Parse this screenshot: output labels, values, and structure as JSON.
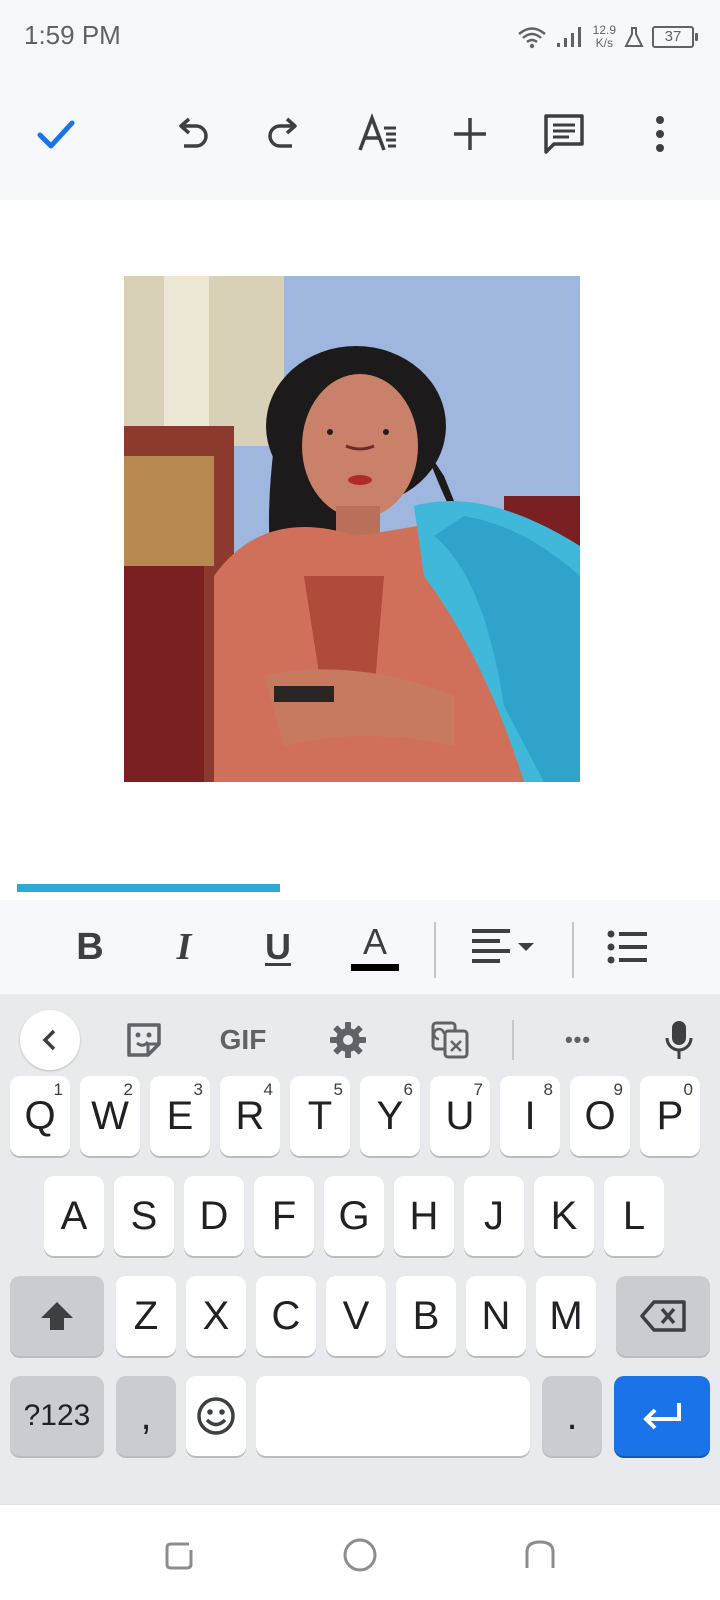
{
  "status_bar": {
    "time": "1:59 PM",
    "net_speed_value": "12.9",
    "net_speed_unit": "K/s",
    "battery": "37"
  },
  "toolbar": {
    "icons": [
      "check-icon",
      "undo-icon",
      "redo-icon",
      "text-format-icon",
      "insert-icon",
      "comment-icon",
      "more-icon"
    ]
  },
  "document": {
    "image": "inserted-photo",
    "upload_progress": 0.37
  },
  "format_bar": {
    "bold": "B",
    "italic": "I",
    "underline": "U",
    "text_color": "A",
    "text_color_value": "#000000"
  },
  "keyboard": {
    "toolbar": {
      "gif_label": "GIF",
      "more_label": "•••"
    },
    "rows": [
      [
        {
          "k": "Q",
          "h": "1"
        },
        {
          "k": "W",
          "h": "2"
        },
        {
          "k": "E",
          "h": "3"
        },
        {
          "k": "R",
          "h": "4"
        },
        {
          "k": "T",
          "h": "5"
        },
        {
          "k": "Y",
          "h": "6"
        },
        {
          "k": "U",
          "h": "7"
        },
        {
          "k": "I",
          "h": "8"
        },
        {
          "k": "O",
          "h": "9"
        },
        {
          "k": "P",
          "h": "0"
        }
      ],
      [
        {
          "k": "A"
        },
        {
          "k": "S"
        },
        {
          "k": "D"
        },
        {
          "k": "F"
        },
        {
          "k": "G"
        },
        {
          "k": "H"
        },
        {
          "k": "J"
        },
        {
          "k": "K"
        },
        {
          "k": "L"
        }
      ],
      [
        {
          "k": "Z"
        },
        {
          "k": "X"
        },
        {
          "k": "C"
        },
        {
          "k": "V"
        },
        {
          "k": "B"
        },
        {
          "k": "N"
        },
        {
          "k": "M"
        }
      ]
    ],
    "symbols_label": "?123",
    "comma_label": ",",
    "period_label": ".",
    "space_label": ""
  },
  "colors": {
    "accent": "#1a73e8",
    "progress": "#2ea8d6",
    "chrome_bg": "#f6f8fc",
    "keyboard_bg": "#e8eaed"
  }
}
